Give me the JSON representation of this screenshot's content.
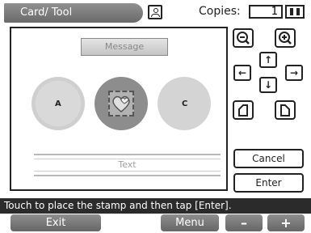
{
  "header": {
    "title": "Card/ Tool",
    "copies_label": "Copies:",
    "copies_value": "1",
    "user_icon": "user-icon"
  },
  "canvas": {
    "message_placeholder": "Message",
    "text_placeholder": "Text",
    "stamps": [
      {
        "label": "A"
      },
      {
        "label": ""
      },
      {
        "label": "C"
      }
    ]
  },
  "controls": {
    "zoom_out": "zoom-out-icon",
    "zoom_in": "zoom-in-icon",
    "cancel_label": "Cancel",
    "enter_label": "Enter"
  },
  "status_text": "Touch to place the stamp and then tap [Enter].",
  "bottom": {
    "exit_label": "Exit",
    "menu_label": "Menu",
    "minus_label": "–",
    "plus_label": "+"
  }
}
